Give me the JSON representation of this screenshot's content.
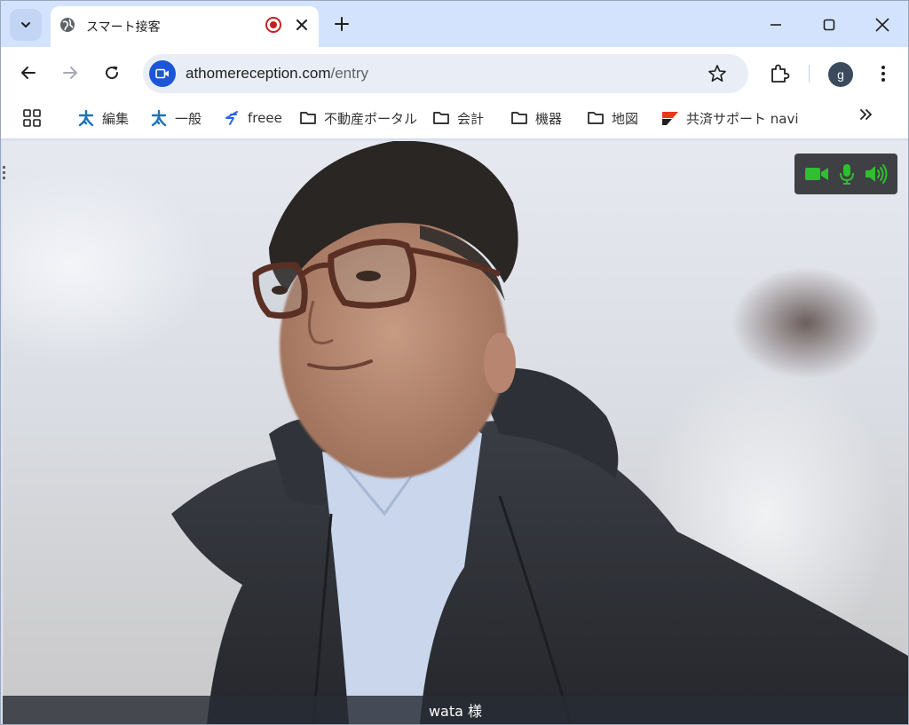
{
  "browser": {
    "tab": {
      "title": "スマート接客",
      "recording": true
    },
    "url": {
      "host": "athomereception.com",
      "path": "/entry"
    },
    "profile_initial": "g",
    "bookmarks": [
      {
        "label": "編集",
        "icon": "taichi-icon"
      },
      {
        "label": "一般",
        "icon": "taichi-icon"
      },
      {
        "label": "freee",
        "icon": "freee-icon"
      },
      {
        "label": "不動産ポータル",
        "icon": "folder-icon"
      },
      {
        "label": "会計",
        "icon": "folder-icon"
      },
      {
        "label": "機器",
        "icon": "folder-icon"
      },
      {
        "label": "地図",
        "icon": "folder-icon"
      },
      {
        "label": "共済サポート navi",
        "icon": "kyosai-icon"
      }
    ]
  },
  "call": {
    "caption": "wata 様",
    "media_status": {
      "camera": "on",
      "mic": "on",
      "speaker": "on",
      "color": "#2fbf2f"
    }
  },
  "colors": {
    "accent": "#1a56d6",
    "record": "#c5221f",
    "tabstrip": "#d3e3fd"
  }
}
